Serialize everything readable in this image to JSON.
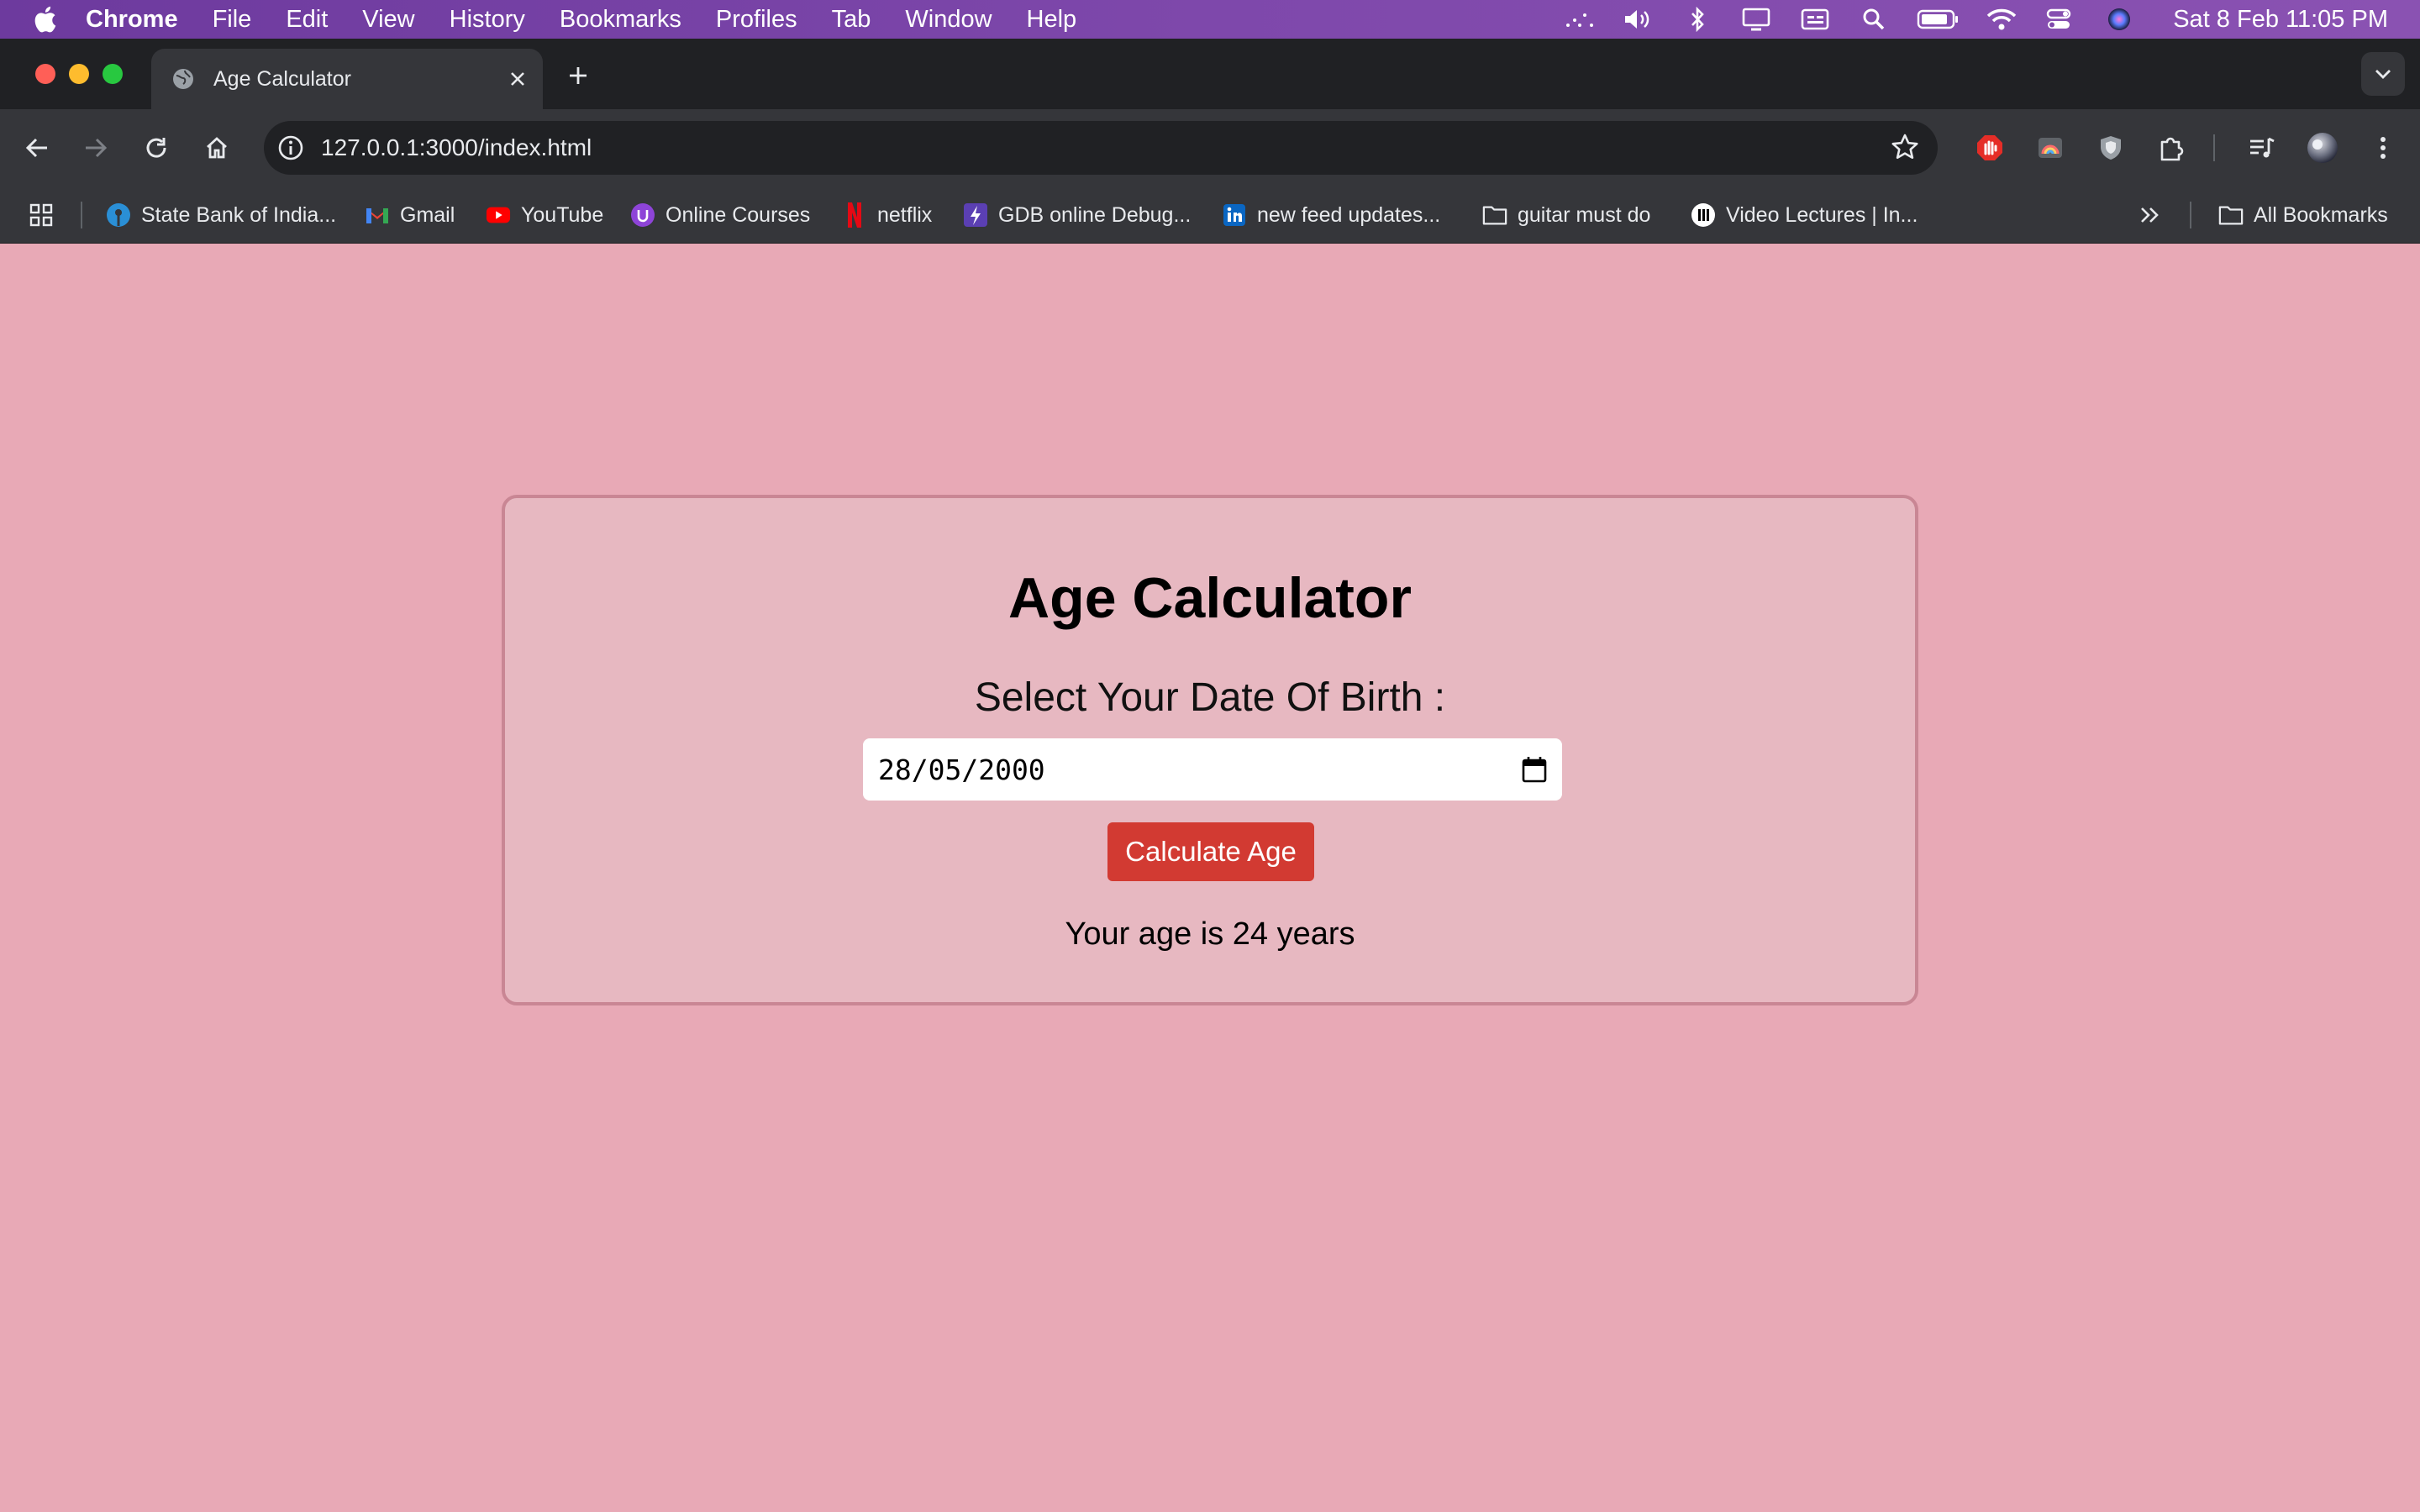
{
  "menubar": {
    "app": "Chrome",
    "items": [
      "File",
      "Edit",
      "View",
      "History",
      "Bookmarks",
      "Profiles",
      "Tab",
      "Window",
      "Help"
    ],
    "clock": "Sat 8 Feb  11:05 PM",
    "status_icons": [
      "display-mirroring-icon",
      "volume-icon",
      "bluetooth-icon",
      "screen-icon",
      "input-icon",
      "spotlight-icon",
      "battery-icon",
      "wifi-icon",
      "control-center-icon",
      "siri-icon"
    ]
  },
  "tab": {
    "title": "Age Calculator"
  },
  "toolbar": {
    "url": "127.0.0.1:3000/index.html"
  },
  "bookmarks": {
    "items": [
      {
        "label": "State Bank of India...",
        "icon": "sbi-icon",
        "color": "#2a8fd6"
      },
      {
        "label": "Gmail",
        "icon": "gmail-icon",
        "color": "#ea4335"
      },
      {
        "label": "YouTube",
        "icon": "youtube-icon",
        "color": "#ff0000"
      },
      {
        "label": "Online Courses",
        "icon": "courses-icon",
        "color": "#8e44d8"
      },
      {
        "label": "netflix",
        "icon": "netflix-icon",
        "color": "#e50914"
      },
      {
        "label": "GDB online Debug...",
        "icon": "gdb-icon",
        "color": "#5b3fb3"
      },
      {
        "label": "new feed updates...",
        "icon": "linkedin-icon",
        "color": "#0a66c2"
      },
      {
        "label": "guitar must do",
        "icon": "folder-icon",
        "color": "#e8eaed"
      },
      {
        "label": "Video Lectures | In...",
        "icon": "lectures-icon",
        "color": "#ffffff"
      }
    ],
    "all_bookmarks": "All Bookmarks"
  },
  "page": {
    "heading": "Age Calculator",
    "label": "Select Your Date Of Birth :",
    "dob_value": "28/05/2000",
    "button": "Calculate Age",
    "result": "Your age is 24 years"
  },
  "colors": {
    "page_bg": "#e8a9b6",
    "card_bg": "#e7b8c1",
    "button": "#d23a32"
  }
}
